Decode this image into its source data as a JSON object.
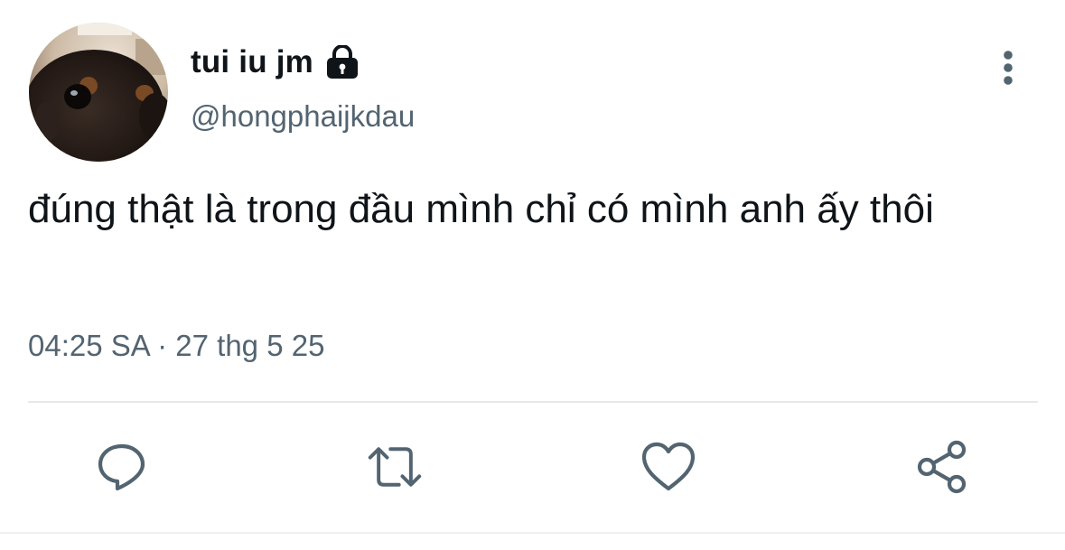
{
  "author": {
    "display_name": "tui iu jm",
    "handle": "@hongphaijkdau",
    "protected": true,
    "avatar": "dog-photo-avatar"
  },
  "tweet": {
    "text": "đúng thật là trong đầu mình chỉ có mình anh ấy thôi",
    "timestamp": "04:25 SA · 27 thg 5 25"
  },
  "icons": {
    "lock": "lock-icon",
    "more": "more-vertical-icon",
    "reply": "reply-icon",
    "retweet": "retweet-icon",
    "like": "heart-icon",
    "share": "share-icon"
  },
  "colors": {
    "text_primary": "#0f1419",
    "text_secondary": "#536471",
    "icon_gray": "#536471",
    "divider": "#e6e9eb"
  }
}
